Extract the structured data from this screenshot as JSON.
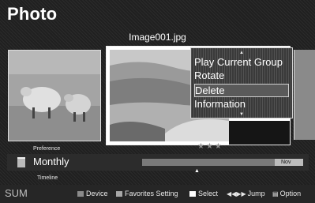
{
  "app": {
    "title": "Photo"
  },
  "viewer": {
    "filename": "Image001.jpg",
    "rating_stars": "★★★"
  },
  "option_menu": {
    "items": [
      {
        "label": "Play Current Group",
        "selected": false
      },
      {
        "label": "Rotate",
        "selected": false
      },
      {
        "label": "Delete",
        "selected": true
      },
      {
        "label": "Information",
        "selected": false
      }
    ],
    "scroll_up": "▲",
    "scroll_down": "▼"
  },
  "sort": {
    "preference_label": "Preference",
    "view_value": "Monthly",
    "timeline_label": "Timeline",
    "end_month": "Nov"
  },
  "footer": {
    "sum_label": "SUM",
    "device_label": "Device",
    "favorites_label": "Favorites Setting",
    "select_label": "Select",
    "jump_label": "Jump",
    "option_label": "Option",
    "colors": {
      "device_key": "#8a8a8a",
      "favorites_key": "#a8a8a8",
      "select_key": "#ffffff"
    }
  }
}
